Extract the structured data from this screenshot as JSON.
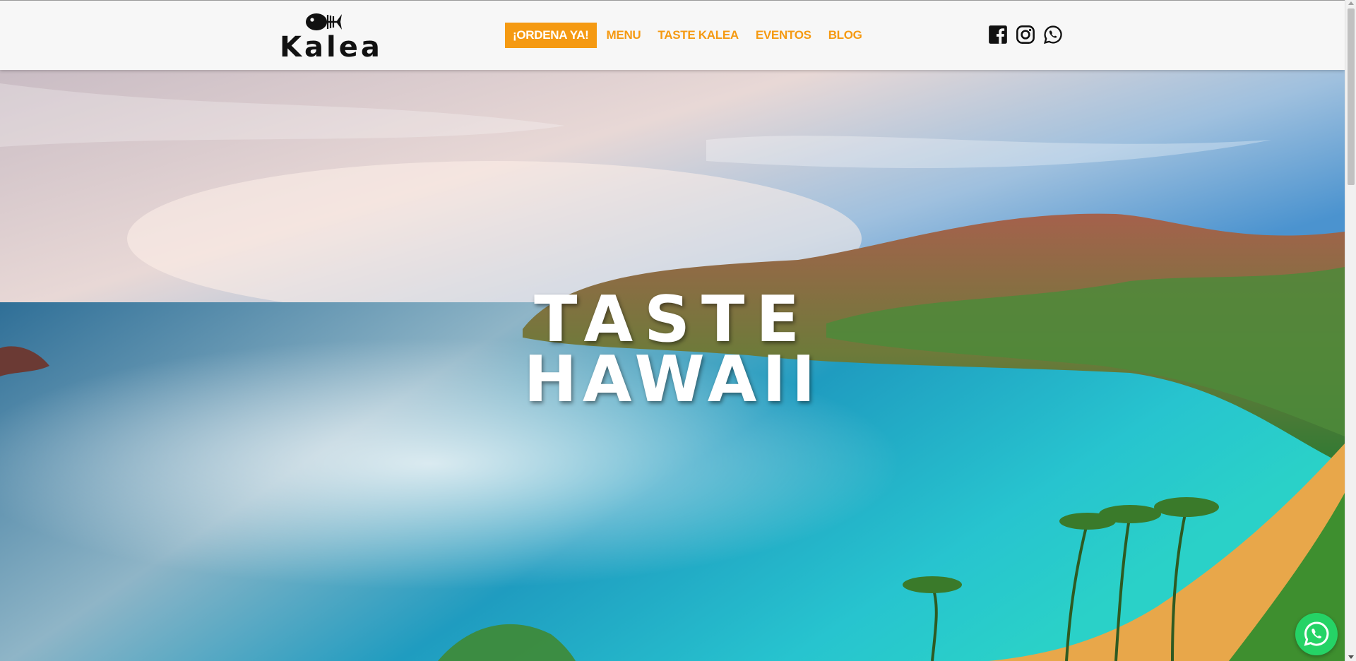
{
  "brand": {
    "name": "Kalea",
    "logo_icon": "fish-skeleton-icon"
  },
  "nav": {
    "order_label": "¡ORDENA YA!",
    "items": [
      {
        "label": "MENU"
      },
      {
        "label": "TASTE KALEA"
      },
      {
        "label": "EVENTOS"
      },
      {
        "label": "BLOG"
      }
    ]
  },
  "social": [
    {
      "name": "Facebook",
      "icon": "facebook-icon"
    },
    {
      "name": "Instagram",
      "icon": "instagram-icon"
    },
    {
      "name": "WhatsApp",
      "icon": "whatsapp-icon"
    }
  ],
  "hero": {
    "line1": "TASTE",
    "line2": "HAWAII"
  },
  "floating_button": {
    "icon": "whatsapp-icon"
  },
  "colors": {
    "accent": "#f59a12",
    "header_bg": "#f7f7f7",
    "whatsapp": "#25d366"
  }
}
